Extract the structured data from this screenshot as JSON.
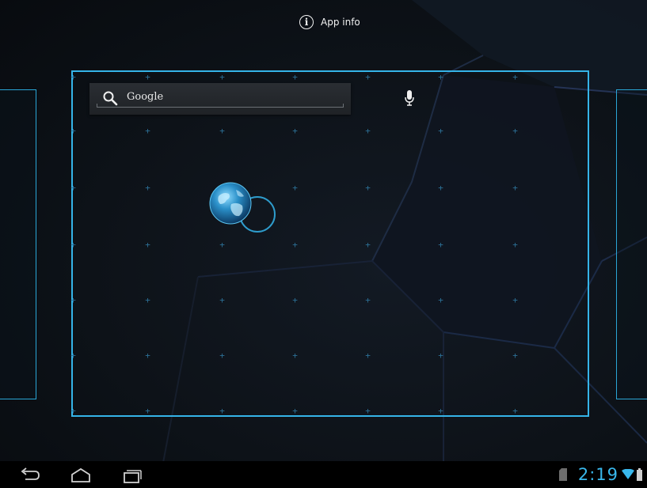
{
  "top_bar": {
    "app_info_label": "App info",
    "app_info_icon": "info-icon"
  },
  "search_widget": {
    "label": "Google",
    "search_icon": "search-icon",
    "voice_icon": "mic-icon"
  },
  "workspace": {
    "dragged_app_icon": "browser-globe-icon"
  },
  "nav_bar": {
    "back_icon": "back-icon",
    "home_icon": "home-icon",
    "recent_apps_icon": "recent-apps-icon"
  },
  "status_bar": {
    "time": "2:19",
    "sd_card_icon": "sd-card-icon",
    "wifi_icon": "wifi-icon",
    "battery_icon": "battery-icon"
  },
  "colors": {
    "accent": "#35b4e8",
    "clock": "#39b8ec",
    "grid_mark": "#2c6f95",
    "background": "#0b0f14",
    "nav_bar": "#000000"
  }
}
